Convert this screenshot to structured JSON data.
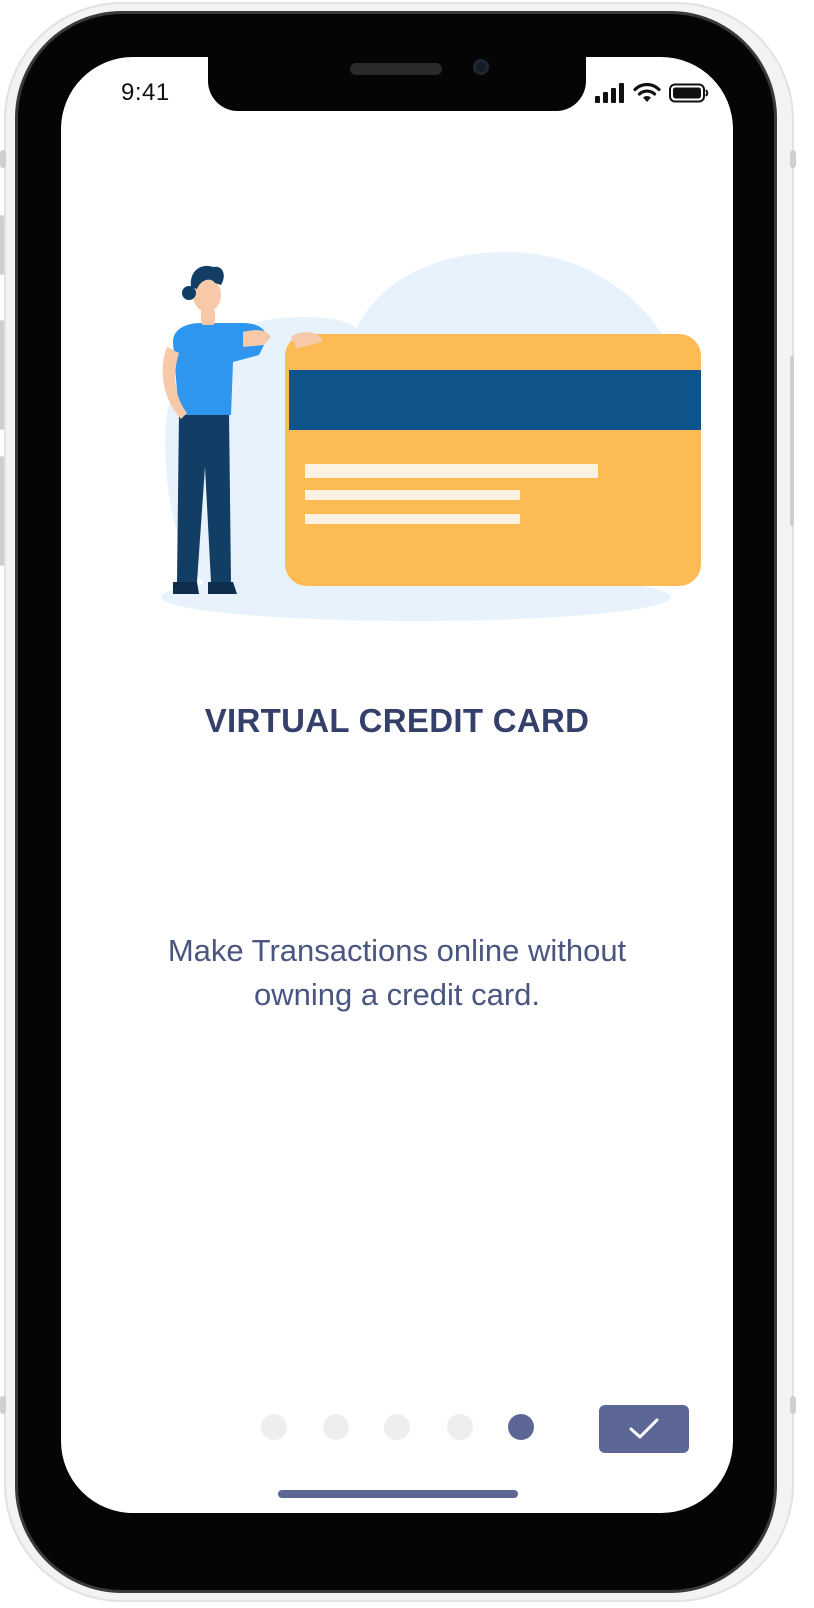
{
  "status_bar": {
    "time": "9:41",
    "icons": [
      "cellular-signal-icon",
      "wifi-icon",
      "battery-icon"
    ]
  },
  "illustration": {
    "name": "person-with-credit-card",
    "colors": {
      "card": "#FDBB55",
      "stripe": "#10548C",
      "background_blob": "#E8F2FC",
      "shirt": "#2F96F0",
      "pants": "#123E66"
    }
  },
  "onboarding": {
    "title": "VIRTUAL CREDIT CARD",
    "description": "Make Transactions online without owning a credit card.",
    "page_count": 5,
    "current_page": 5
  },
  "done_button": {
    "icon": "check-icon",
    "color": "#5D6795"
  },
  "theme": {
    "accent": "#5D6795",
    "title_color": "#35406A",
    "text_color": "#4A5580"
  }
}
